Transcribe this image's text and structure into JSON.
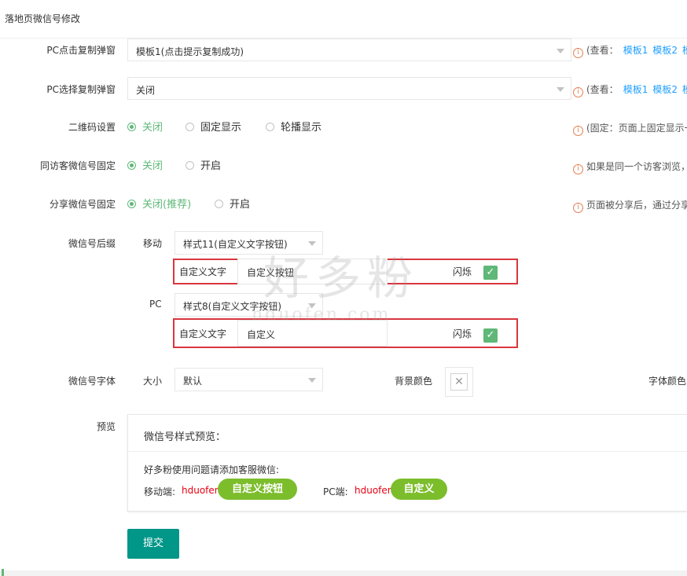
{
  "header": {
    "title": "落地页微信号修改"
  },
  "rows": {
    "pc_click": {
      "label": "PC点击复制弹窗",
      "value": "模板1(点击提示复制成功)",
      "hint_prefix": "(查看：",
      "links": [
        "模板1",
        "模板2",
        "模"
      ]
    },
    "pc_select": {
      "label": "PC选择复制弹窗",
      "value": "关闭",
      "hint_prefix": "(查看：",
      "links": [
        "模板1",
        "模板2",
        "模"
      ]
    },
    "qrcode": {
      "label": "二维码设置",
      "options": [
        "关闭",
        "固定显示",
        "轮播显示"
      ],
      "selected": 0,
      "hint": "(固定：页面上固定显示一"
    },
    "same_visitor": {
      "label": "同访客微信号固定",
      "options": [
        "关闭",
        "开启"
      ],
      "selected": 0,
      "hint": "如果是同一个访客浏览，"
    },
    "share": {
      "label": "分享微信号固定",
      "options": [
        "关闭(推荐)",
        "开启"
      ],
      "selected": 0,
      "hint": "页面被分享后，通过分享"
    }
  },
  "suffix": {
    "label": "微信号后缀",
    "mobile": {
      "label": "移动",
      "style": "样式11(自定义文字按钮)",
      "text_label": "自定义文字",
      "text_value": "自定义按钮",
      "blink_label": "闪烁",
      "blink_checked": true
    },
    "pc": {
      "label": "PC",
      "style": "样式8(自定义文字按钮)",
      "text_label": "自定义文字",
      "text_value": "自定义",
      "blink_label": "闪烁",
      "blink_checked": true
    }
  },
  "font": {
    "label": "微信号字体",
    "size_label": "大小",
    "size_value": "默认",
    "bg_label": "背景颜色",
    "color_label": "字体颜色"
  },
  "preview": {
    "label": "预览",
    "title": "微信号样式预览：",
    "line": "好多粉使用问题请添加客服微信:",
    "mobile_label": "移动端:",
    "mobile_id": "hduofen",
    "mobile_button": "自定义按钮",
    "pc_label": "PC端:",
    "pc_id": "hduofen",
    "pc_button": "自定义"
  },
  "submit_label": "提交",
  "watermark": {
    "cn": "好多粉",
    "en": "hduofen.com"
  },
  "colors": {
    "accent_green": "#5fb878",
    "button_green": "#7cbd2c",
    "submit_teal": "#009688",
    "link_blue": "#1e9fff",
    "highlight_red": "#d9363e",
    "id_red": "#e60012"
  }
}
